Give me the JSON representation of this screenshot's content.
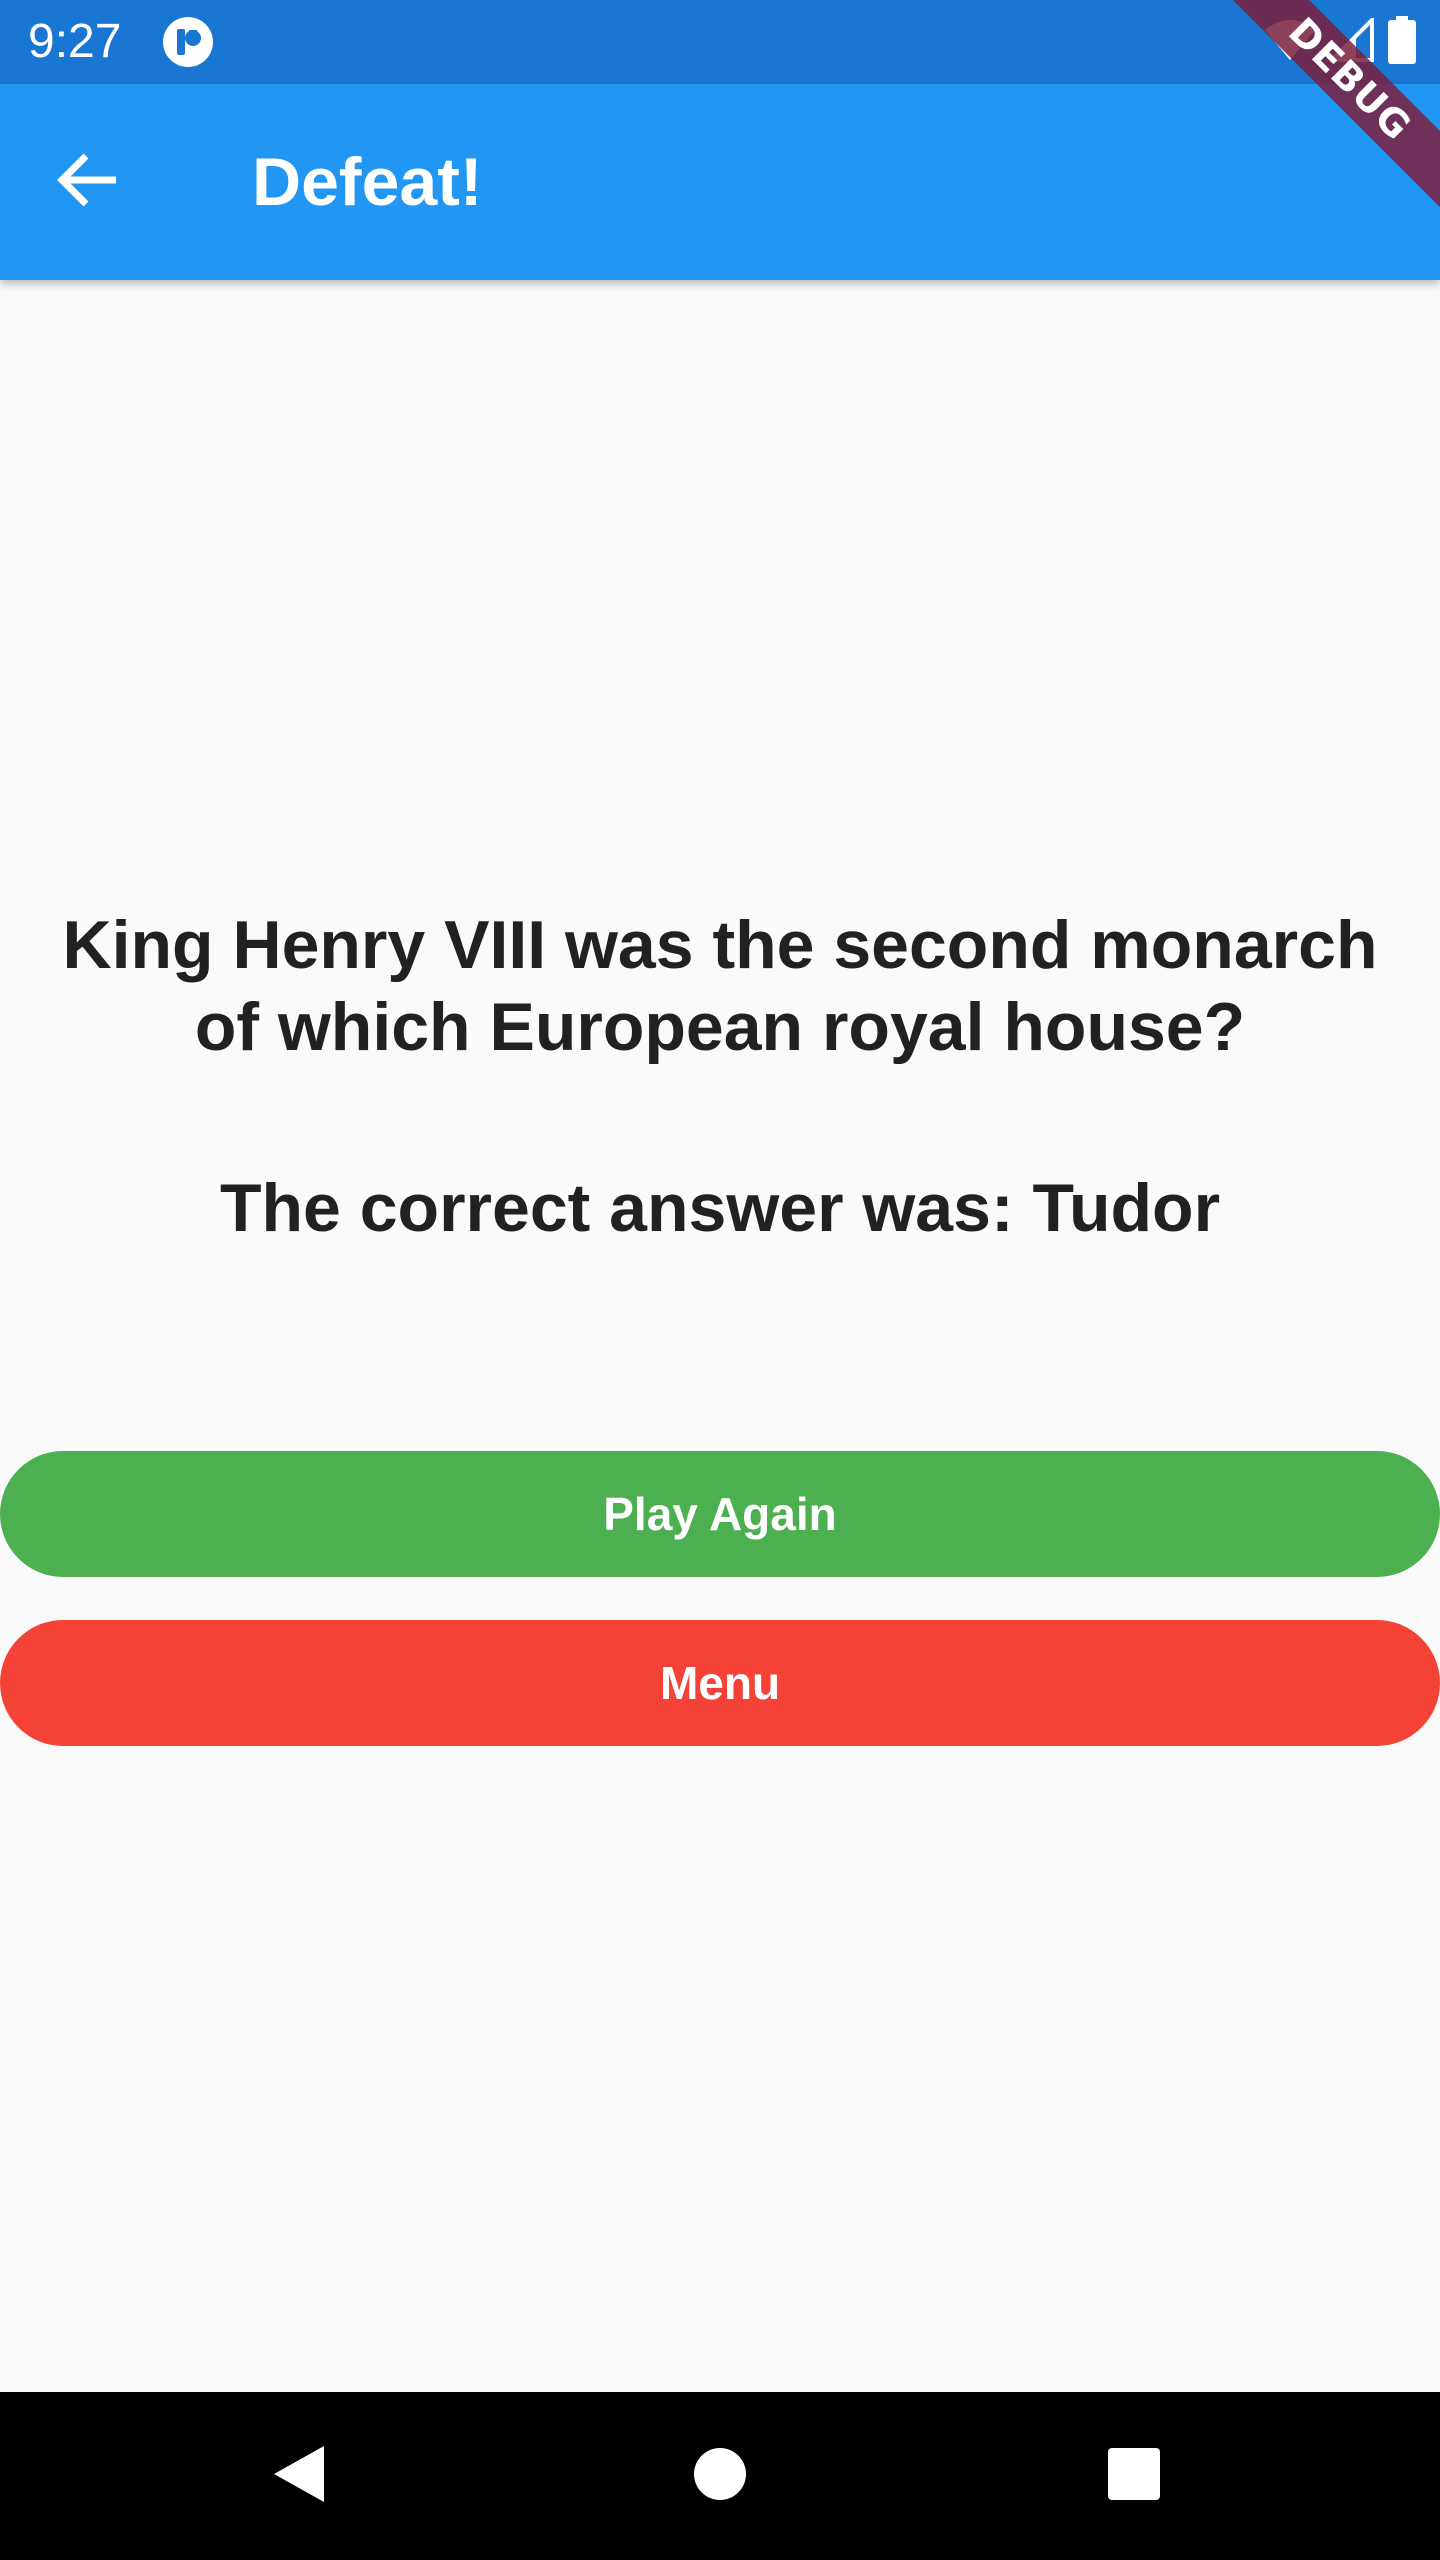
{
  "status_bar": {
    "time": "9:27",
    "background": "#1976d2",
    "icons": [
      "app-notification-icon",
      "wifi-icon",
      "cellular-signal-icon",
      "battery-icon"
    ]
  },
  "app_bar": {
    "title": "Defeat!",
    "background": "#2196f3",
    "back_icon": "arrow-back-icon"
  },
  "debug_banner": {
    "label": "DEBUG",
    "color": "#7a203e"
  },
  "content": {
    "question": "King Henry VIII was the second monarch of which European royal house?",
    "answer": "The correct answer was: Tudor"
  },
  "buttons": {
    "play_again": {
      "label": "Play Again",
      "color": "#4caf50"
    },
    "menu": {
      "label": "Menu",
      "color": "#f44336"
    }
  },
  "nav_bar": {
    "icons": [
      "nav-back-icon",
      "nav-home-icon",
      "nav-recents-icon"
    ]
  }
}
